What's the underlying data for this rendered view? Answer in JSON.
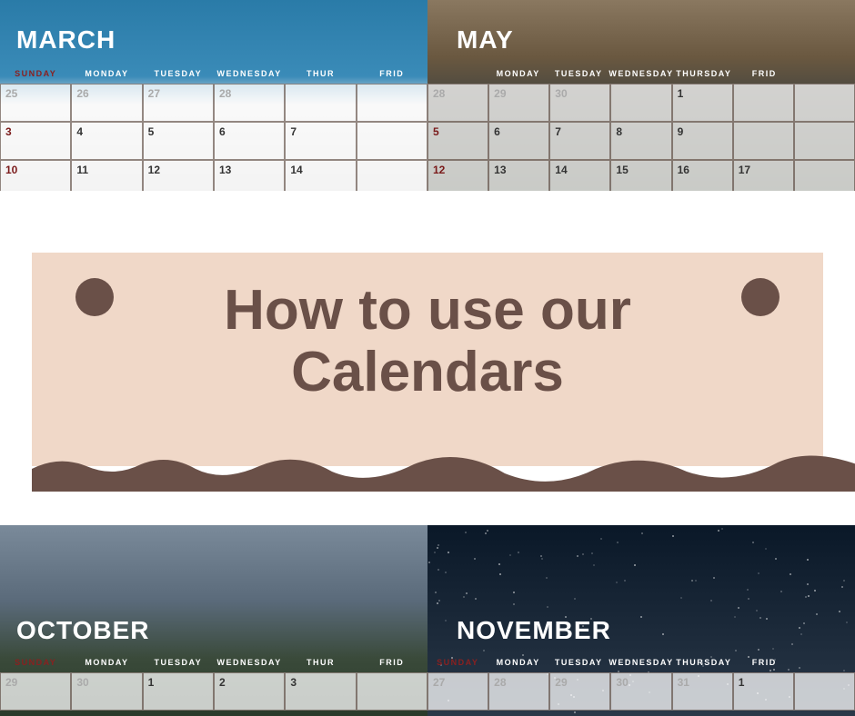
{
  "banner": {
    "title": "How to use our Calendars"
  },
  "day_names": [
    "SUNDAY",
    "MONDAY",
    "TUESDAY",
    "WEDNESDAY",
    "THURSDAY",
    "FRIDAY"
  ],
  "calendars": {
    "march": {
      "title": "MARCH",
      "rows": [
        [
          {
            "n": "25",
            "other": true
          },
          {
            "n": "26",
            "other": true
          },
          {
            "n": "27",
            "other": true
          },
          {
            "n": "28",
            "other": true
          },
          {
            "n": "",
            "other": true
          },
          {
            "n": "",
            "other": true
          }
        ],
        [
          {
            "n": "3",
            "sun": true
          },
          {
            "n": "4"
          },
          {
            "n": "5"
          },
          {
            "n": "6"
          },
          {
            "n": "7"
          },
          {
            "n": ""
          }
        ],
        [
          {
            "n": "10",
            "sun": true
          },
          {
            "n": "11"
          },
          {
            "n": "12"
          },
          {
            "n": "13"
          },
          {
            "n": "14"
          },
          {
            "n": ""
          }
        ]
      ]
    },
    "may": {
      "title": "MAY",
      "rows": [
        [
          {
            "n": "28",
            "other": true
          },
          {
            "n": "29",
            "other": true
          },
          {
            "n": "30",
            "other": true
          },
          {
            "n": "",
            "other": true
          },
          {
            "n": "1"
          },
          {
            "n": ""
          },
          {
            "n": ""
          }
        ],
        [
          {
            "n": "5",
            "sun": true
          },
          {
            "n": "6"
          },
          {
            "n": "7"
          },
          {
            "n": "8"
          },
          {
            "n": "9"
          },
          {
            "n": ""
          },
          {
            "n": ""
          }
        ],
        [
          {
            "n": "12",
            "sun": true
          },
          {
            "n": "13"
          },
          {
            "n": "14"
          },
          {
            "n": "15"
          },
          {
            "n": "16"
          },
          {
            "n": "17"
          },
          {
            "n": ""
          }
        ]
      ]
    },
    "october": {
      "title": "OCTOBER",
      "rows": [
        [
          {
            "n": "29",
            "other": true
          },
          {
            "n": "30",
            "other": true
          },
          {
            "n": "1"
          },
          {
            "n": "2"
          },
          {
            "n": "3"
          },
          {
            "n": ""
          }
        ]
      ]
    },
    "november": {
      "title": "NOVEMBER",
      "rows": [
        [
          {
            "n": "27",
            "other": true
          },
          {
            "n": "28",
            "other": true
          },
          {
            "n": "29",
            "other": true
          },
          {
            "n": "30",
            "other": true
          },
          {
            "n": "31",
            "other": true
          },
          {
            "n": "1"
          },
          {
            "n": ""
          }
        ]
      ]
    }
  },
  "colors": {
    "banner_bg": "#f0d8c8",
    "banner_fg": "#6a5048",
    "sunday": "#7a1a1a"
  }
}
